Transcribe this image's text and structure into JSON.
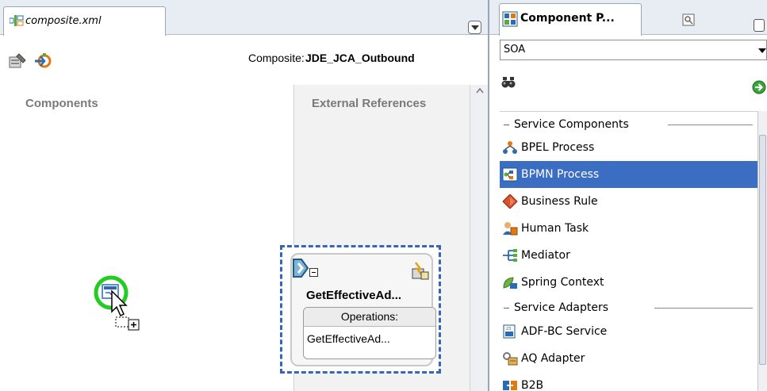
{
  "editor": {
    "tab_label": "composite.xml",
    "composite_label": "Composite:",
    "composite_name": "JDE_JCA_Outbound",
    "components_heading": "Components",
    "external_references_heading": "External References",
    "reference": {
      "title": "GetEffectiveAd...",
      "operations_header": "Operations:",
      "operations": [
        "GetEffectiveAd..."
      ]
    }
  },
  "palette": {
    "tab_label": "Component P...",
    "selected_category": "SOA",
    "search": {
      "value": "",
      "placeholder": ""
    },
    "sections": [
      {
        "label": "Service Components",
        "items": [
          {
            "label": "BPEL Process",
            "icon": "bpel-process-icon",
            "selected": false
          },
          {
            "label": "BPMN Process",
            "icon": "bpmn-process-icon",
            "selected": true
          },
          {
            "label": "Business Rule",
            "icon": "business-rule-icon",
            "selected": false
          },
          {
            "label": "Human Task",
            "icon": "human-task-icon",
            "selected": false
          },
          {
            "label": "Mediator",
            "icon": "mediator-icon",
            "selected": false
          },
          {
            "label": "Spring Context",
            "icon": "spring-context-icon",
            "selected": false
          }
        ]
      },
      {
        "label": "Service Adapters",
        "items": [
          {
            "label": "ADF-BC Service",
            "icon": "adf-bc-service-icon",
            "selected": false
          },
          {
            "label": "AQ Adapter",
            "icon": "aq-adapter-icon",
            "selected": false
          },
          {
            "label": "B2B",
            "icon": "b2b-icon",
            "selected": false
          }
        ]
      }
    ]
  },
  "colors": {
    "selection": "#3b6ec2",
    "dashed_border": "#3566b9",
    "heading_gray": "#7a7a7a",
    "drop_circle": "#22cc22"
  }
}
